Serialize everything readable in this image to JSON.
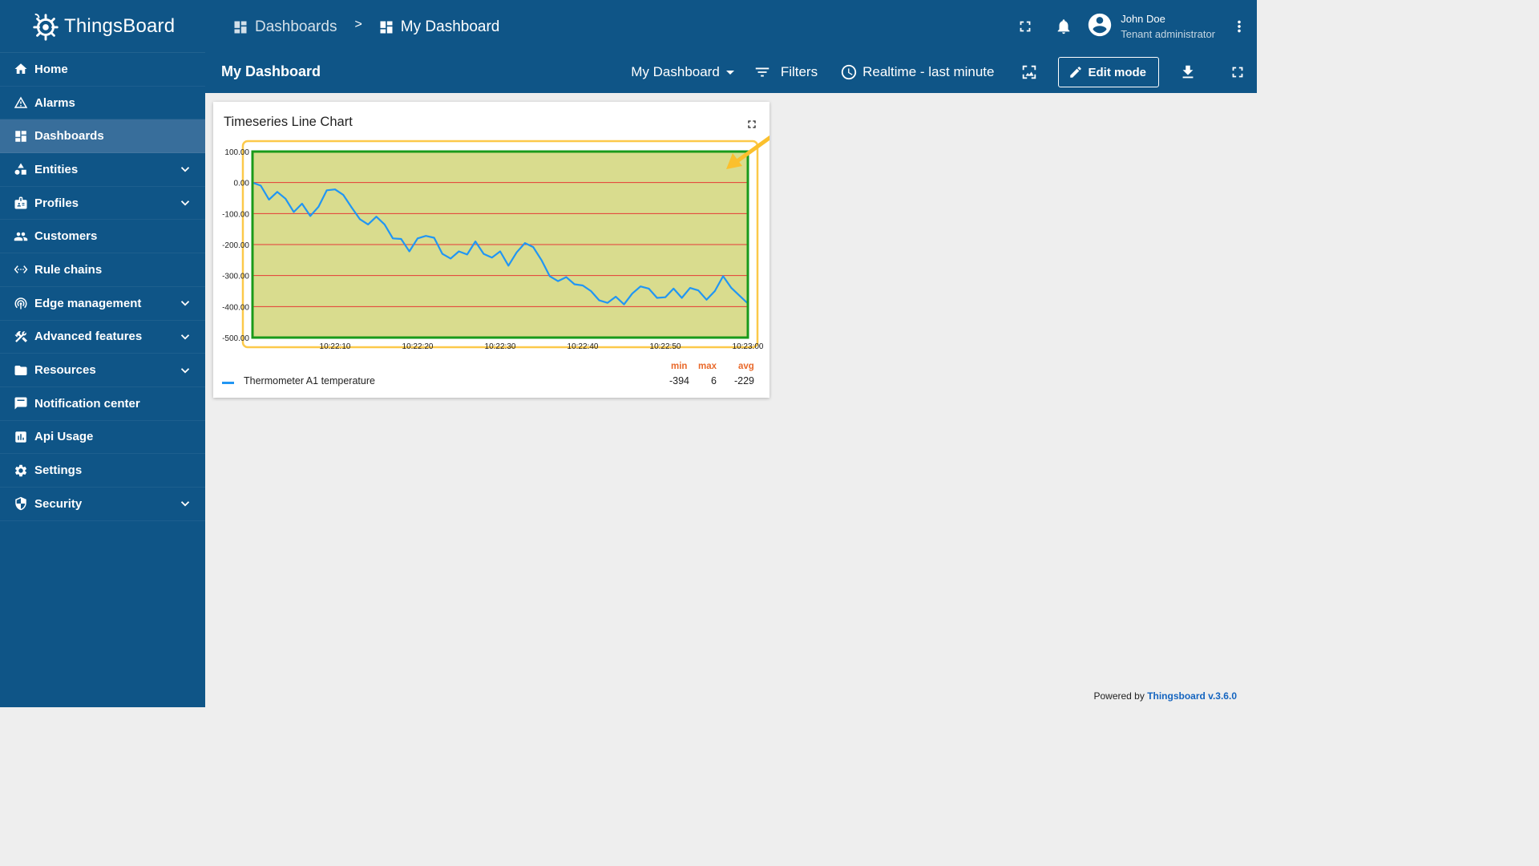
{
  "app": {
    "name": "ThingsBoard"
  },
  "sidebar": {
    "items": [
      {
        "label": "Home",
        "icon": "home-icon",
        "expandable": false,
        "active": false
      },
      {
        "label": "Alarms",
        "icon": "warning-icon",
        "expandable": false,
        "active": false
      },
      {
        "label": "Dashboards",
        "icon": "dashboard-icon",
        "expandable": false,
        "active": true
      },
      {
        "label": "Entities",
        "icon": "entities-icon",
        "expandable": true,
        "active": false
      },
      {
        "label": "Profiles",
        "icon": "badge-icon",
        "expandable": true,
        "active": false
      },
      {
        "label": "Customers",
        "icon": "people-icon",
        "expandable": false,
        "active": false
      },
      {
        "label": "Rule chains",
        "icon": "settings-ethernet-icon",
        "expandable": false,
        "active": false
      },
      {
        "label": "Edge management",
        "icon": "router-icon",
        "expandable": true,
        "active": false
      },
      {
        "label": "Advanced features",
        "icon": "construction-icon",
        "expandable": true,
        "active": false
      },
      {
        "label": "Resources",
        "icon": "folder-icon",
        "expandable": true,
        "active": false
      },
      {
        "label": "Notification center",
        "icon": "chat-icon",
        "expandable": false,
        "active": false
      },
      {
        "label": "Api Usage",
        "icon": "insert-chart-icon",
        "expandable": false,
        "active": false
      },
      {
        "label": "Settings",
        "icon": "gear-icon",
        "expandable": false,
        "active": false
      },
      {
        "label": "Security",
        "icon": "security-shield-icon",
        "expandable": true,
        "active": false
      }
    ]
  },
  "header": {
    "breadcrumbs": [
      {
        "label": "Dashboards",
        "icon": "dashboard-icon"
      },
      {
        "label": "My Dashboard",
        "icon": "dashboard-icon"
      }
    ],
    "separator": ">",
    "user": {
      "name": "John Doe",
      "role": "Tenant administrator"
    }
  },
  "toolbar": {
    "dashboard_title": "My Dashboard",
    "dashboard_select": "My Dashboard",
    "filters_label": "Filters",
    "timewindow_label": "Realtime - last minute",
    "edit_mode_label": "Edit mode"
  },
  "widget": {
    "title": "Timeseries Line Chart",
    "legend": {
      "headers": {
        "min": "min",
        "max": "max",
        "avg": "avg"
      },
      "series": [
        {
          "name": "Thermometer A1 temperature",
          "min": "-394",
          "max": "6",
          "avg": "-229",
          "color": "#2196f3"
        }
      ]
    }
  },
  "chart_data": {
    "type": "line",
    "title": "Timeseries Line Chart",
    "xlabel": "",
    "ylabel": "",
    "ylim": [
      -500,
      100
    ],
    "yticks": [
      "100.00",
      "0.00",
      "-100.00",
      "-200.00",
      "-300.00",
      "-400.00",
      "-500.00"
    ],
    "xticks": [
      "10:22:10",
      "10:22:20",
      "10:22:30",
      "10:22:40",
      "10:22:50",
      "10:23:00"
    ],
    "xrange_seconds": [
      0,
      60
    ],
    "xtick_seconds": [
      10,
      20,
      30,
      40,
      50,
      60
    ],
    "grid": true,
    "background_color": "#d9dc8e",
    "grid_color": "#e53935",
    "border_color": "#1a9a1a",
    "series": [
      {
        "name": "Thermometer A1 temperature",
        "color": "#2196f3",
        "x": [
          0,
          1,
          2,
          3,
          4,
          5,
          6,
          7,
          8,
          9,
          10,
          11,
          12,
          13,
          14,
          15,
          16,
          17,
          18,
          19,
          20,
          21,
          22,
          23,
          24,
          25,
          26,
          27,
          28,
          29,
          30,
          31,
          32,
          33,
          34,
          35,
          36,
          37,
          38,
          39,
          40,
          41,
          42,
          43,
          44,
          45,
          46,
          47,
          48,
          49,
          50,
          51,
          52,
          53,
          54,
          55,
          56,
          57,
          58,
          59,
          60
        ],
        "values": [
          0,
          -10,
          -55,
          -30,
          -52,
          -95,
          -68,
          -108,
          -78,
          -25,
          -22,
          -40,
          -80,
          -118,
          -135,
          -110,
          -135,
          -180,
          -182,
          -222,
          -180,
          -172,
          -178,
          -230,
          -245,
          -222,
          -232,
          -190,
          -230,
          -242,
          -222,
          -268,
          -225,
          -195,
          -208,
          -250,
          -302,
          -318,
          -305,
          -328,
          -332,
          -350,
          -380,
          -388,
          -368,
          -393,
          -358,
          -335,
          -342,
          -372,
          -370,
          -342,
          -372,
          -340,
          -348,
          -378,
          -350,
          -302,
          -340,
          -365,
          -390
        ]
      }
    ]
  },
  "footer": {
    "prefix": "Powered by",
    "link": "Thingsboard v.3.6.0"
  }
}
